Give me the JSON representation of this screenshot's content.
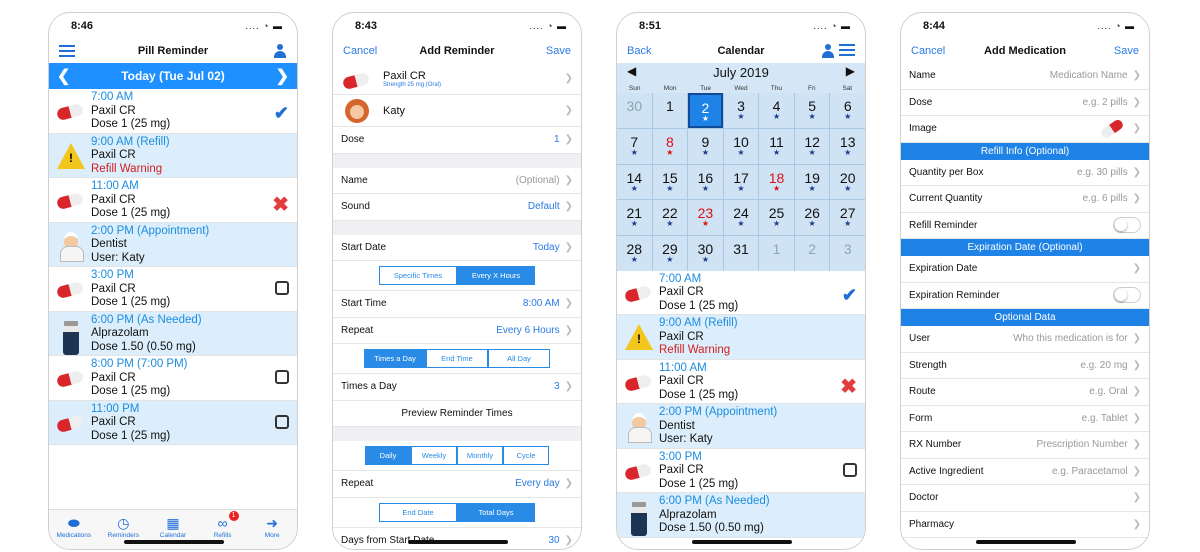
{
  "p1": {
    "time": "8:46",
    "title": "Pill Reminder",
    "date": "Today (Tue Jul 02)",
    "reminders": [
      {
        "time": "7:00 AM",
        "name": "Paxil CR",
        "detail": "Dose 1 (25 mg)",
        "icon": "pill-icon",
        "status": "checkmark-icon"
      },
      {
        "time": "9:00 AM (Refill)",
        "name": "Paxil CR",
        "detail": "Refill Warning",
        "icon": "warning-icon",
        "status": ""
      },
      {
        "time": "11:00 AM",
        "name": "Paxil CR",
        "detail": "Dose 1 (25 mg)",
        "icon": "pill-icon",
        "status": "x-icon"
      },
      {
        "time": "2:00 PM (Appointment)",
        "name": "Dentist",
        "detail": "User: Katy",
        "icon": "doctor-icon",
        "status": ""
      },
      {
        "time": "3:00 PM",
        "name": "Paxil CR",
        "detail": "Dose 1 (25 mg)",
        "icon": "pill-icon",
        "status": "checkbox"
      },
      {
        "time": "6:00 PM (As Needed)",
        "name": "Alprazolam",
        "detail": "Dose 1.50 (0.50 mg)",
        "icon": "bottle-icon",
        "status": ""
      },
      {
        "time": "8:00 PM (7:00 PM)",
        "name": "Paxil CR",
        "detail": "Dose 1 (25 mg)",
        "icon": "pill-icon",
        "status": "checkbox"
      },
      {
        "time": "11:00 PM",
        "name": "Paxil CR",
        "detail": "Dose 1 (25 mg)",
        "icon": "pill-icon",
        "status": "checkbox"
      }
    ],
    "tabs": [
      "Medications",
      "Reminders",
      "Calendar",
      "Refills",
      "More"
    ],
    "badge": "1"
  },
  "p2": {
    "time": "8:43",
    "cancel": "Cancel",
    "title": "Add Reminder",
    "save": "Save",
    "med": "Paxil CR",
    "strength": "Strength 25 mg (Oral)",
    "user": "Katy",
    "dose_label": "Dose",
    "dose_value": "1",
    "name_label": "Name",
    "name_value": "(Optional)",
    "sound_label": "Sound",
    "sound_value": "Default",
    "start_label": "Start Date",
    "start_value": "Today",
    "seg1": [
      "Specific Times",
      "Every X Hours"
    ],
    "starttime_label": "Start Time",
    "starttime_value": "8:00 AM",
    "repeat_label": "Repeat",
    "repeat_value": "Every 6 Hours",
    "seg2": [
      "Times a Day",
      "End Time",
      "All Day"
    ],
    "times_label": "Times a Day",
    "times_value": "3",
    "preview": "Preview Reminder Times",
    "seg3": [
      "Daily",
      "Weekly",
      "Monthly",
      "Cycle"
    ],
    "repeat2_label": "Repeat",
    "repeat2_value": "Every day",
    "seg4": [
      "End Date",
      "Total Days"
    ],
    "days_label": "Days from Start Date",
    "days_value": "30"
  },
  "p3": {
    "time": "8:51",
    "back": "Back",
    "title": "Calendar",
    "month": "July 2019",
    "dows": [
      "Sun",
      "Mon",
      "Tue",
      "Wed",
      "Thu",
      "Fri",
      "Sat"
    ],
    "days": [
      [
        "30",
        "dim",
        ""
      ],
      [
        "1",
        "",
        ""
      ],
      [
        "2",
        "sel",
        "★"
      ],
      [
        "3",
        "",
        "★"
      ],
      [
        "4",
        "",
        "★"
      ],
      [
        "5",
        "",
        "★"
      ],
      [
        "6",
        "",
        "★"
      ],
      [
        "7",
        "",
        "★"
      ],
      [
        "8",
        "red",
        "★"
      ],
      [
        "9",
        "",
        "★"
      ],
      [
        "10",
        "",
        "★"
      ],
      [
        "11",
        "",
        "★"
      ],
      [
        "12",
        "",
        "★"
      ],
      [
        "13",
        "",
        "★"
      ],
      [
        "14",
        "",
        "★"
      ],
      [
        "15",
        "",
        "★"
      ],
      [
        "16",
        "",
        "★"
      ],
      [
        "17",
        "",
        "★"
      ],
      [
        "18",
        "red",
        "★"
      ],
      [
        "19",
        "",
        "★"
      ],
      [
        "20",
        "",
        "★"
      ],
      [
        "21",
        "",
        "★"
      ],
      [
        "22",
        "",
        "★"
      ],
      [
        "23",
        "red",
        "★"
      ],
      [
        "24",
        "",
        "★"
      ],
      [
        "25",
        "",
        "★"
      ],
      [
        "26",
        "",
        "★"
      ],
      [
        "27",
        "",
        "★"
      ],
      [
        "28",
        "",
        "★"
      ],
      [
        "29",
        "",
        "★"
      ],
      [
        "30",
        "",
        "★"
      ],
      [
        "31",
        "",
        ""
      ],
      [
        "1",
        "dim",
        ""
      ],
      [
        "2",
        "dim",
        ""
      ],
      [
        "3",
        "dim",
        ""
      ]
    ],
    "reminders": [
      {
        "time": "7:00 AM",
        "name": "Paxil CR",
        "detail": "Dose 1 (25 mg)",
        "icon": "pill-icon",
        "status": "checkmark-icon"
      },
      {
        "time": "9:00 AM (Refill)",
        "name": "Paxil CR",
        "detail": "Refill Warning",
        "icon": "warning-icon",
        "status": ""
      },
      {
        "time": "11:00 AM",
        "name": "Paxil CR",
        "detail": "Dose 1 (25 mg)",
        "icon": "pill-icon",
        "status": "x-icon"
      },
      {
        "time": "2:00 PM (Appointment)",
        "name": "Dentist",
        "detail": "User: Katy",
        "icon": "doctor-icon",
        "status": ""
      },
      {
        "time": "3:00 PM",
        "name": "Paxil CR",
        "detail": "Dose 1 (25 mg)",
        "icon": "pill-icon",
        "status": "checkbox"
      },
      {
        "time": "6:00 PM (As Needed)",
        "name": "Alprazolam",
        "detail": "Dose 1.50 (0.50 mg)",
        "icon": "bottle-icon",
        "status": ""
      }
    ]
  },
  "p4": {
    "time": "8:44",
    "cancel": "Cancel",
    "title": "Add Medication",
    "save": "Save",
    "rows1": [
      [
        "Name",
        "Medication Name"
      ],
      [
        "Dose",
        "e.g. 2 pills"
      ],
      [
        "Image",
        ""
      ]
    ],
    "hdr1": "Refill Info (Optional)",
    "rows2": [
      [
        "Quantity per Box",
        "e.g. 30 pills"
      ],
      [
        "Current Quantity",
        "e.g. 6 pills"
      ],
      [
        "Refill Reminder",
        ""
      ]
    ],
    "hdr2": "Expiration Date (Optional)",
    "rows3": [
      [
        "Expiration Date",
        ""
      ],
      [
        "Expiration Reminder",
        ""
      ]
    ],
    "hdr3": "Optional Data",
    "rows4": [
      [
        "User",
        "Who this medication is for"
      ],
      [
        "Strength",
        "e.g. 20 mg"
      ],
      [
        "Route",
        "e.g. Oral"
      ],
      [
        "Form",
        "e.g. Tablet"
      ],
      [
        "RX Number",
        "Prescription Number"
      ],
      [
        "Active Ingredient",
        "e.g. Paracetamol"
      ],
      [
        "Doctor",
        ""
      ],
      [
        "Pharmacy",
        ""
      ]
    ]
  },
  "colors": {
    "accent": "#1e90ff",
    "warn": "#d21f1f"
  }
}
